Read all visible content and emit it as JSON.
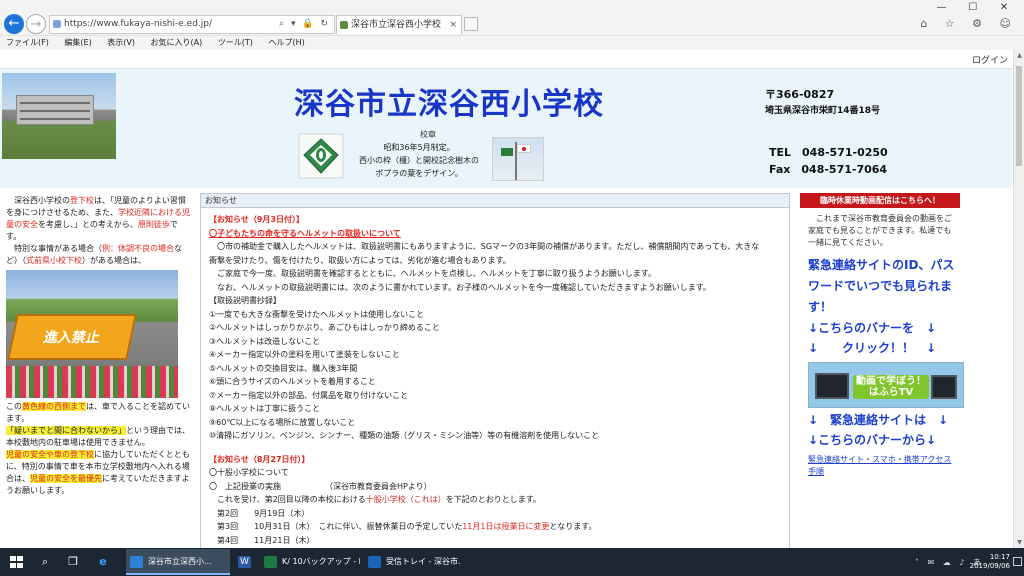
{
  "browser": {
    "url": "https://www.fukaya-nishi-e.ed.jp/",
    "addr_tools": "⌕ ▾ 🔒 ↻",
    "tab_title": "深谷市立深谷西小学校",
    "tab_close": "×",
    "window_controls": {
      "min": "—",
      "max": "☐",
      "close": "✕"
    },
    "tools": "⌂ ☆ ⚙ ☺",
    "menu": [
      "ファイル(F)",
      "編集(E)",
      "表示(V)",
      "お気に入り(A)",
      "ツール(T)",
      "ヘルプ(H)"
    ]
  },
  "header": {
    "login": "ログイン",
    "title": "深谷市立深谷西小学校",
    "emblem_label": "校章",
    "emblem_desc_1": "昭和36年5月制定。",
    "emblem_desc_2": "西小の枠（橿）と開校記念樹木の",
    "emblem_desc_3": "ポプラの葉をデザイン。",
    "postal": "〒366‐0827",
    "street": "埼玉県深谷市栄町14番18号",
    "tel": "TEL　048‐571‐0250",
    "fax": "Fax　048‐571‐7064"
  },
  "left": {
    "p1_a": "　深谷西小学校の",
    "p1_b": "登下校",
    "p1_c": "は、「児童のよりよい習慣を身につけさせるため、また、",
    "p1_d": "学校近隣における児童の安全",
    "p1_e": "を考慮し、」との考えから、",
    "p1_f": "原則徒歩",
    "p1_g": "です。",
    "p2_a": "　特別な事情がある場合（",
    "p2_b": "例：体調不良の場合",
    "p2_c": "など）（",
    "p2_d": "式前県小校下校",
    "p2_e": "）がある場合は、",
    "sign": "進入禁止",
    "p3_a": "この",
    "p3_b": "黄色線の西側まで",
    "p3_c": "は、車で入ることを認めています。",
    "p4_a": "「疑いまでと間に合わないから」",
    "p4_b": "という理由では、本校敷地内の駐車場は使用できません。",
    "p5_a": "児童の安全や車の登下校",
    "p5_b": "に協力していただくとともに、特別の事情で車を本市立学校敷地内へ入れる場合は、",
    "p5_c": "児童の安全を最優先",
    "p5_d": "に考えていただきますようお願いします。"
  },
  "center": {
    "header": "お知らせ",
    "notice1_title": "【お知らせ（9月3日付）】",
    "notice1_sub": "〇子どもたちの命を守るヘルメットの取扱いについて",
    "p1": "　〇市の補助金で購入したヘルメットは、取扱説明書にもありますように、SGマークの3年間の補償があります。ただし、補償期間内であっても、大きな",
    "p1b": "衝撃を受けたり、傷を付けたり、取扱い方によっては、劣化が進む場合もあります。",
    "p2": "　ご家庭で今一度、取扱説明書を確認するとともに、ヘルメットを点検し、ヘルメットを丁寧に取り扱うようお願いします。",
    "p3": "　なお、ヘルメットの取扱説明書には、次のように書かれています。お子様のヘルメットを今一度確認していただきますようお願いします。",
    "list_head": "【取扱説明書抄録】",
    "items": [
      "①一度でも大きな衝撃を受けたヘルメットは使用しないこと",
      "②ヘルメットはしっかりかぶり、あごひもはしっかり締めること",
      "③ヘルメットは改造しないこと",
      "④メーカー指定以外の塗料を用いて塗装をしないこと",
      "⑤ヘルメットの交換目安は、購入後3年間",
      "⑥頭に合うサイズのヘルメットを着用すること",
      "⑦メーカー指定以外の部品、付属品を取り付けないこと",
      "⑧ヘルメットは丁寧に扱うこと",
      "⑨60℃以上になる場所に放置しないこと",
      "⑩清掃にガソリン、ベンジン、シンナー、種類の油類（グリス・ミシン油等）等の有機溶剤を使用しないこと"
    ],
    "notice2_title": "【お知らせ（8月27日付）】",
    "n2_l1": "〇十股小学校について",
    "n2_l2": "〇　上記授業の実施　　　　　　（深谷市教育委員会HPより）",
    "n2_l3_a": "　これを受け、第2回目以降の本校における",
    "n2_l3_b": "十股小学校（これは）",
    "n2_l3_c": "を下記のとおりとします。",
    "n2_l4": "　第2回　　9月19日（木）　　　",
    "n2_l5_a": "　第3回　　10月31日（木）　これに伴い、振替休業日の予定していた",
    "n2_l5_b": "11月1日は授業日に変更",
    "n2_l5_c": "となります。",
    "n2_l6": "　第4回　　11月21日（木）"
  },
  "right": {
    "video_btn": "臨時休業時動画配信はこちらへ！",
    "video_text": "　これまで深谷市教育委員会の動画をご家庭でも見ることができます。私達でも一緒に見てください。",
    "bigblue": "緊急連絡サイトのID、パスワードでいつでも見られます！",
    "arrow1": "↓こちらのバナーを　↓",
    "arrow2": "↓　　クリック！！　↓",
    "banner": "動画で学ぼう！はふらTV",
    "emerg1": "↓　緊急連絡サイトは　↓",
    "emerg2": "↓こちらのバナーから↓",
    "emerg_link": "緊急連絡サイト・スマホ・携帯アクセス手順"
  },
  "taskbar": {
    "search": "⌕",
    "view": "❐",
    "ie": "e",
    "task1": "深谷市立深西小...",
    "task2": "W",
    "task3": "K/ 10バックアップ - Ex...",
    "task4": "受信トレイ - 深谷市...",
    "tray": "˄ ✉ ☁ ♪ あ",
    "clock_time": "10:17",
    "clock_date": "2019/09/06"
  },
  "colors": {
    "accent_blue": "#1a36c9",
    "notice_red": "#e0261e",
    "highlight_yellow": "#f6ee36",
    "video_button_red": "#c3171b"
  }
}
